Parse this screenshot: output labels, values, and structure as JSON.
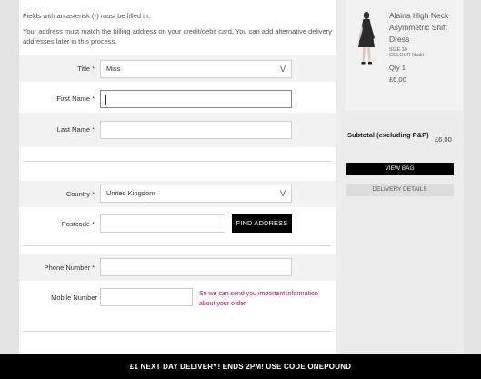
{
  "form": {
    "required_note_prefix": "Fields with an asterisk (",
    "required_note_asterisk": "*",
    "required_note_suffix": ") must be filled in.",
    "billing_note": "Your address must match the billing address on your credit/debit card. You can add alternative delivery addresses later in this process.",
    "required_marker": "*",
    "title": {
      "label": "Title",
      "value": "Miss",
      "arrow": "V"
    },
    "first_name": {
      "label": "First Name",
      "value": ""
    },
    "last_name": {
      "label": "Last Name",
      "value": ""
    },
    "country": {
      "label": "Country",
      "value": "United Kingdom",
      "arrow": "V"
    },
    "postcode": {
      "label": "Postcode",
      "value": "",
      "find_button": "FIND ADDRESS"
    },
    "phone": {
      "label": "Phone Number",
      "value": ""
    },
    "mobile": {
      "label": "Mobile Number",
      "value": "",
      "help": "So we can send you important information about your order"
    }
  },
  "summary": {
    "product_name": "Alaina High Neck Asymmetric Shift Dress",
    "size": "SIZE 10",
    "colour": "COLOUR khaki",
    "qty": "Qty 1",
    "price": "£6.00",
    "subtotal_label": "Subtotal (excluding P&P)",
    "subtotal_value": "£6.00",
    "view_bag": "VIEW BAG",
    "delivery_details": "DELIVERY DETAILS"
  },
  "promo": {
    "text": "£1 NEXT DAY DELIVERY! ENDS 2PM! USE CODE ONEPOUND"
  }
}
